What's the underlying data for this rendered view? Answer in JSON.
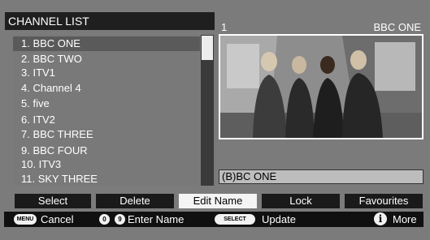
{
  "header": {
    "title": "CHANNEL LIST"
  },
  "channels": [
    {
      "label": "1. BBC ONE",
      "selected": true
    },
    {
      "label": "2. BBC TWO"
    },
    {
      "label": "3. ITV1"
    },
    {
      "label": "4. Channel 4"
    },
    {
      "label": "5. five"
    },
    {
      "label": "6. ITV2"
    },
    {
      "label": "7. BBC THREE"
    },
    {
      "label": "9. BBC FOUR"
    },
    {
      "label": "10. ITV3"
    },
    {
      "label": "11. SKY THREE"
    }
  ],
  "info": {
    "number": "1",
    "name": "BBC ONE"
  },
  "edit_field": {
    "value": "(B)BC ONE"
  },
  "buttons": {
    "select": "Select",
    "delete": "Delete",
    "edit_name": "Edit Name",
    "lock": "Lock",
    "favourites": "Favourites"
  },
  "hints": {
    "menu_key": "MENU",
    "cancel": "Cancel",
    "key_0": "0",
    "key_9": "9",
    "enter_name": "Enter Name",
    "select_key": "SELECT",
    "update": "Update",
    "info_key": "i",
    "more": "More"
  },
  "colors": {
    "background": "#7b7b7b",
    "bar": "#1a1a1a",
    "active_button": "#f4f4f4",
    "edit_field": "#bdbdbd"
  }
}
